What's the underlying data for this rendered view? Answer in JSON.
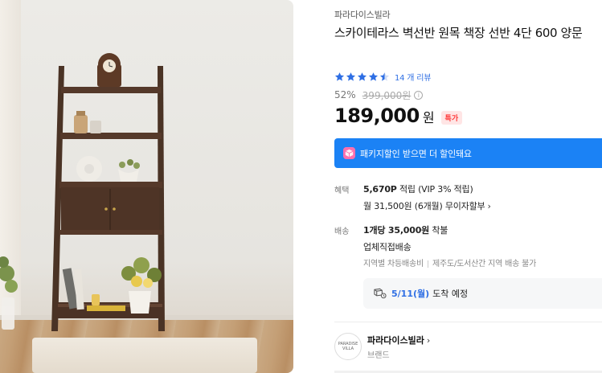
{
  "product": {
    "brand": "파라다이스빌라",
    "title": "스카이테라스 벽선반 원목 책장 선반 4단 600 양문",
    "rating_value": 4.5,
    "review_count": "14 개 리뷰",
    "discount_rate": "52%",
    "original_price": "399,000원",
    "price": "189,000",
    "currency": "원",
    "special_badge": "특가"
  },
  "package": {
    "banner_text": "패키지할인 받으면 더 할인돼요"
  },
  "benefit": {
    "label": "혜택",
    "points": "5,670P",
    "points_suffix": "적립 (VIP 3% 적립)",
    "installment": "월 31,500원 (6개월) 무이자할부"
  },
  "shipping": {
    "label": "배송",
    "fee": "1개당 35,000원",
    "fee_suffix": "착불",
    "method": "업체직접배송",
    "note_1": "지역별 차등배송비",
    "note_2": "제주도/도서산간 지역 배송 불가",
    "arrival_date": "5/11(월)",
    "arrival_text": "도착 예정"
  },
  "seller": {
    "name": "파라다이스빌라",
    "subtitle": "브랜드",
    "logo_text": "PARADISE VILLA"
  },
  "icons": {
    "star": "star-icon",
    "info": "info-icon",
    "package": "package-icon",
    "truck": "truck-icon",
    "chevron": "chevron-right-icon"
  },
  "colors": {
    "accent_blue": "#1b82f5",
    "star_blue": "#2f6fe4",
    "badge_red": "#ff3b3b"
  }
}
